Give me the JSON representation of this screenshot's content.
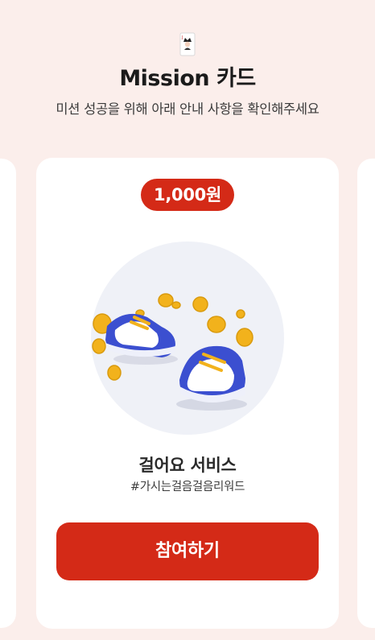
{
  "header": {
    "title": "Mission 카드",
    "subtitle": "미션 성공을 위해 아래 안내 사항을 확인해주세요",
    "icon": "joker-card-icon"
  },
  "mission_card": {
    "reward": "1,000원",
    "illustration": "sneakers-with-coins",
    "service_name": "걸어요 서비스",
    "service_tag": "#가시는걸음걸음리워드",
    "join_label": "참여하기"
  },
  "colors": {
    "background": "#fbeeeb",
    "accent": "#d42a17",
    "card": "#ffffff",
    "shoe_blue": "#3b4fd0",
    "coin_gold": "#f2b21c"
  }
}
